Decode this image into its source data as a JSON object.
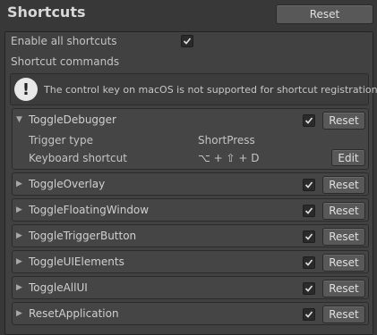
{
  "header": {
    "title": "Shortcuts",
    "reset_label": "Reset"
  },
  "settings": {
    "enable_all_label": "Enable all shortcuts",
    "enable_all_checked": true,
    "commands_label": "Shortcut commands"
  },
  "help": {
    "icon": "!",
    "text": "The control key on macOS is not supported for shortcut registration."
  },
  "commands": [
    {
      "name": "ToggleDebugger",
      "expanded": true,
      "checked": true,
      "reset_label": "Reset",
      "trigger_type_label": "Trigger type",
      "trigger_type_value": "ShortPress",
      "keyboard_shortcut_label": "Keyboard shortcut",
      "keyboard_shortcut_value": "⌥ + ⇧ + D",
      "edit_label": "Edit"
    },
    {
      "name": "ToggleOverlay",
      "expanded": false,
      "checked": true,
      "reset_label": "Reset"
    },
    {
      "name": "ToggleFloatingWindow",
      "expanded": false,
      "checked": true,
      "reset_label": "Reset"
    },
    {
      "name": "ToggleTriggerButton",
      "expanded": false,
      "checked": true,
      "reset_label": "Reset"
    },
    {
      "name": "ToggleUIElements",
      "expanded": false,
      "checked": true,
      "reset_label": "Reset"
    },
    {
      "name": "ToggleAllUI",
      "expanded": false,
      "checked": true,
      "reset_label": "Reset"
    },
    {
      "name": "ResetApplication",
      "expanded": false,
      "checked": true,
      "reset_label": "Reset"
    }
  ]
}
